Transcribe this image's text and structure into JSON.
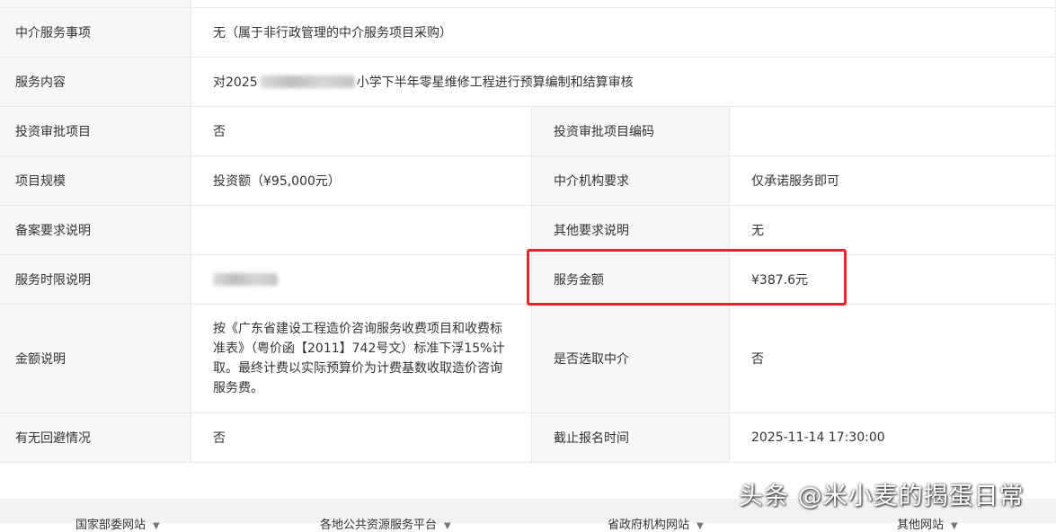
{
  "rows": [
    {
      "label": "中介服务事项",
      "value": "无（属于非行政管理的中介服务项目采购）"
    },
    {
      "label": "服务内容",
      "value_prefix": "对2025",
      "value_suffix": "小学下半年零星维修工程进行预算编制和结算审核"
    },
    {
      "label": "投资审批项目",
      "value": "否",
      "label2": "投资审批项目编码",
      "value2": ""
    },
    {
      "label": "项目规模",
      "value": "投资额（¥95,000元）",
      "label2": "中介机构要求",
      "value2": "仅承诺服务即可"
    },
    {
      "label": "备案要求说明",
      "value": "",
      "label2": "其他要求说明",
      "value2": "无"
    },
    {
      "label": "服务时限说明",
      "value": "",
      "label2": "服务金额",
      "value2": "¥387.6元"
    },
    {
      "label": "金额说明",
      "value_lines": [
        "按《广东省建设工程造价咨询服务收费项目和收费标",
        "准表》（粤价函【2011】742号文）标准下浮15%计",
        "取。最终计费以实际预算价为计费基数收取造价咨询",
        "服务费。"
      ],
      "label2": "是否选取中介",
      "value2": "否"
    },
    {
      "label": "有无回避情况",
      "value": "否",
      "label2": "截止报名时间",
      "value2": "2025-11-14 17:30:00"
    }
  ],
  "footer": {
    "links": [
      "国家部委网站",
      "各地公共资源服务平台",
      "省政府机构网站",
      "其他网站"
    ]
  },
  "watermark": "头条 @米小麦的揭蛋日常",
  "colors": {
    "highlight": "#e0272c",
    "label_bg": "#f7f7f7",
    "border": "#e8e8e8"
  }
}
